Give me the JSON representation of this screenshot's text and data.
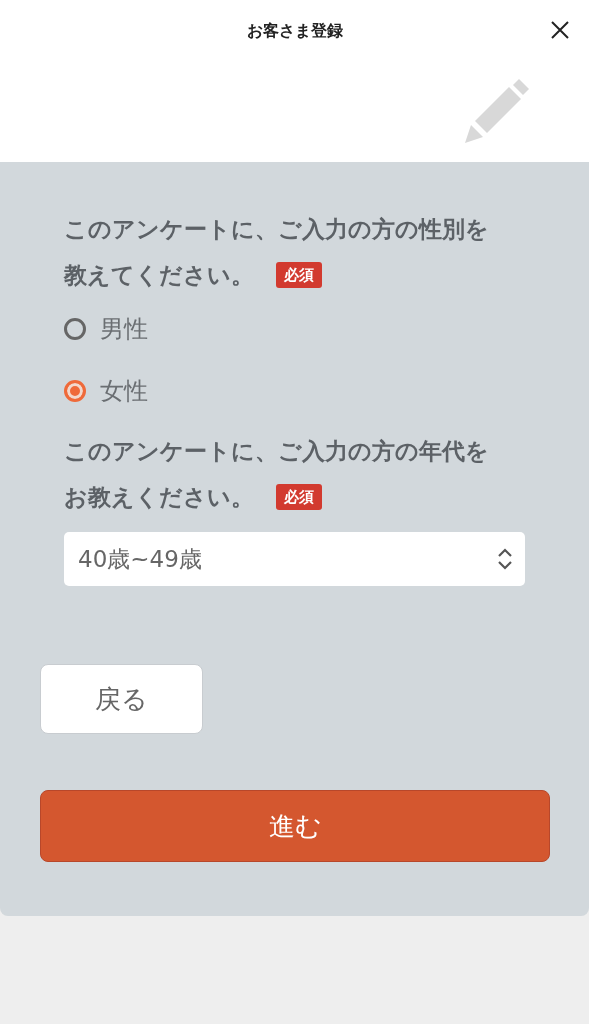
{
  "header": {
    "title": "お客さま登録"
  },
  "questions": [
    {
      "kind": "radio",
      "lines": [
        "このアンケートに、ご入力の方の性別を",
        "教えてください。"
      ],
      "badge": "必須",
      "options": [
        {
          "label": "男性",
          "selected": false
        },
        {
          "label": "女性",
          "selected": true
        }
      ]
    },
    {
      "kind": "select",
      "lines": [
        "このアンケートに、ご入力の方の年代を",
        "お教えください。"
      ],
      "badge": "必須",
      "value": "40歳~49歳"
    }
  ],
  "buttons": {
    "back": "戻る",
    "next": "進む"
  }
}
